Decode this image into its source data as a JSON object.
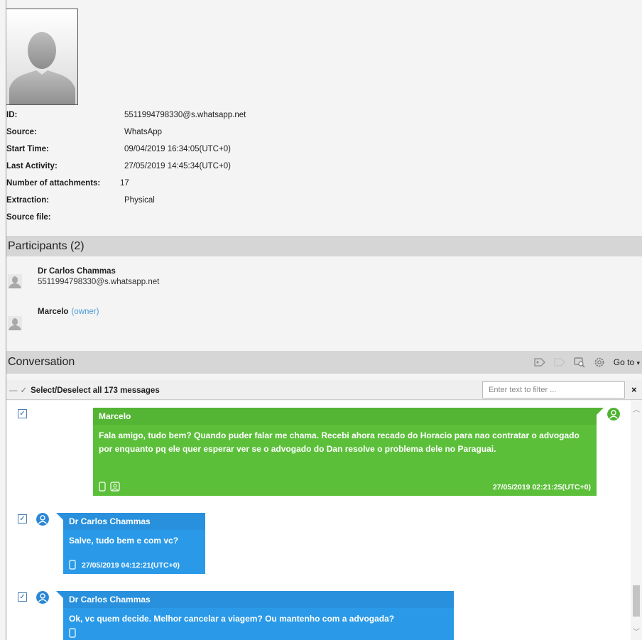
{
  "properties": [
    {
      "key": "ID:",
      "value": "5511994798330@s.whatsapp.net"
    },
    {
      "key": "Source:",
      "value": "WhatsApp"
    },
    {
      "key": "Start Time:",
      "value": "09/04/2019 16:34:05(UTC+0)"
    },
    {
      "key": "Last Activity:",
      "value": "27/05/2019 14:45:34(UTC+0)"
    },
    {
      "key": "Number of attachments:",
      "value": "17"
    },
    {
      "key": "Extraction:",
      "value": "Physical"
    },
    {
      "key": "Source file:",
      "value": ""
    }
  ],
  "participants": {
    "title": "Participants (2)",
    "items": [
      {
        "name": "Dr Carlos Chammas",
        "id": "5511994798330@s.whatsapp.net",
        "owner": ""
      },
      {
        "name": "Marcelo",
        "id": "",
        "owner": "(owner)"
      }
    ]
  },
  "conversation": {
    "title": "Conversation",
    "goto_label": "Go to",
    "select_all_label": "Select/Deselect all 173 messages",
    "filter_placeholder": "Enter text to filter ...",
    "clear_glyph": "×",
    "messages": [
      {
        "sender": "Marcelo",
        "text": "Fala amigo, tudo bem? Quando puder falar me chama. Recebi ahora recado do Horacio para nao contratar o advogado por enquanto pq ele quer esperar ver se o advogado do Dan resolve o problema dele no Paraguai.",
        "timestamp": "27/05/2019 02:21:25(UTC+0)",
        "direction": "outgoing",
        "checked": true
      },
      {
        "sender": "Dr Carlos Chammas",
        "text": "Salve, tudo bem e com vc?",
        "timestamp": "27/05/2019 04:12:21(UTC+0)",
        "direction": "incoming",
        "checked": true
      },
      {
        "sender": "Dr Carlos Chammas",
        "text": "Ok, vc quem decide. Melhor cancelar a viagem? Ou mantenho com a advogada?",
        "timestamp": "",
        "direction": "incoming",
        "checked": true
      }
    ]
  },
  "colors": {
    "outgoing_bubble": "#5cbf3a",
    "incoming_bubble": "#2a9ae8",
    "section_header": "#d6d6d6",
    "owner_link": "#4a9ad8"
  }
}
